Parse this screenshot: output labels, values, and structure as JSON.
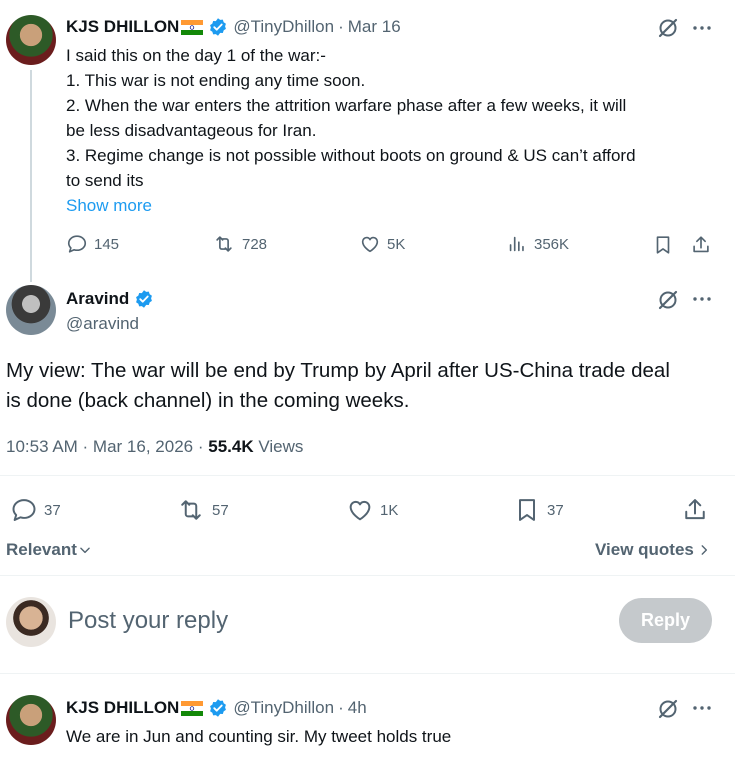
{
  "parent_tweet": {
    "author_name": "KJS DHILLON",
    "handle": "@TinyDhillon",
    "time": "Mar 16",
    "lines": [
      "I said this on the day 1 of the war:-",
      "1. This war is not ending any time soon.",
      "2. When the war enters the attrition warfare phase after a few weeks, it will",
      "be less disadvantageous for Iran.",
      "3. Regime change is not possible without boots on ground & US can’t afford",
      "to send its"
    ],
    "show_more": "Show more",
    "replies": "145",
    "reposts": "728",
    "likes": "5K",
    "views": "356K"
  },
  "main_tweet": {
    "author_name": "Aravind",
    "handle": "@aravind",
    "text_line1": "My view: The war will be end by Trump by April after US-China trade deal",
    "text_line2": "is done (back channel) in the coming weeks.",
    "timestamp": "10:53 AM · Mar 16, 2026 ·",
    "views_count": "55.4K",
    "views_label": "Views",
    "replies": "37",
    "reposts": "57",
    "likes": "1K",
    "bookmarks": "37"
  },
  "sort": {
    "label": "Relevant"
  },
  "view_quotes": "View quotes",
  "composer": {
    "placeholder": "Post your reply",
    "button": "Reply"
  },
  "reply_tweet": {
    "author_name": "KJS DHILLON",
    "handle": "@TinyDhillon",
    "time": "4h",
    "text": "We are in Jun and counting sir. My tweet holds true"
  },
  "colors": {
    "accent": "#1d9bf0",
    "muted": "#536471",
    "reply_button": "#c5c9cc"
  },
  "icons": [
    "grok-icon",
    "more-icon",
    "reply-icon",
    "repost-icon",
    "like-icon",
    "views-icon",
    "bookmark-icon",
    "share-icon",
    "verified-badge-icon",
    "india-flag-icon",
    "chevron-down-icon",
    "chevron-right-icon"
  ]
}
